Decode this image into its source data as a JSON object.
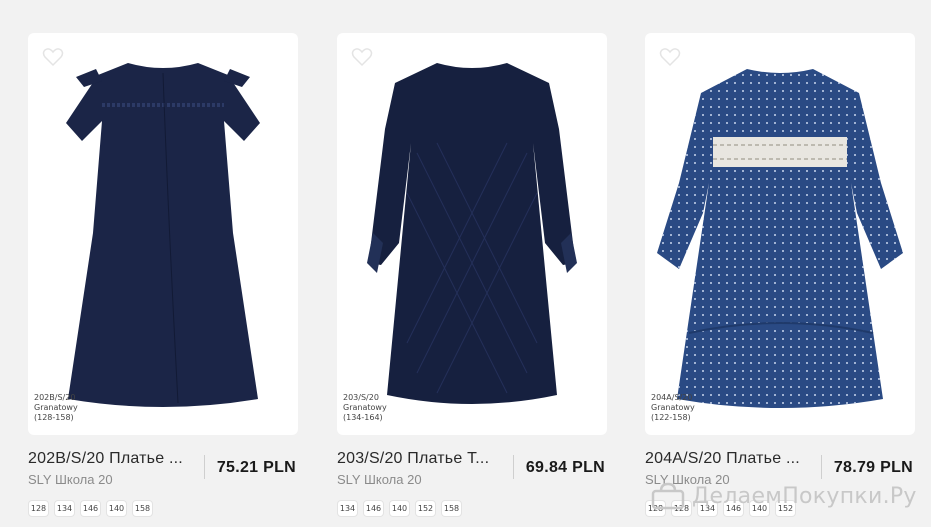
{
  "products": [
    {
      "title": "202B/S/20 Платье ...",
      "brand": "SLY Школа 20",
      "price": "75.21 PLN",
      "tag": [
        "202B/S/20",
        "Granatowy",
        "(128-158)"
      ],
      "sizes": [
        "128",
        "134",
        "146",
        "140",
        "158"
      ],
      "color": "#1b2547"
    },
    {
      "title": "203/S/20 Платье T...",
      "brand": "SLY Школа 20",
      "price": "69.84 PLN",
      "tag": [
        "203/S/20",
        "Granatowy",
        "(134-164)"
      ],
      "sizes": [
        "134",
        "146",
        "140",
        "152",
        "158"
      ],
      "color": "#16203f"
    },
    {
      "title": "204A/S/20 Платье ...",
      "brand": "SLY Школа 20",
      "price": "78.79 PLN",
      "tag": [
        "204A/S/20",
        "Granatowy",
        "(122-158)"
      ],
      "sizes": [
        "128",
        "128",
        "134",
        "146",
        "140",
        "152"
      ],
      "color": "#2a4a84"
    }
  ],
  "watermark": {
    "text": "ДелаемПокупки.Ру",
    "icon": "shopping-bag-icon"
  }
}
